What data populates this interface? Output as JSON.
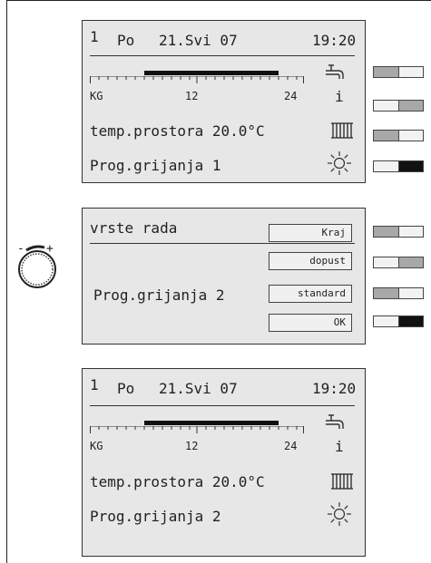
{
  "panel_top": {
    "line_no": "1",
    "day": "Po",
    "date": "21.Svi 07",
    "time": "19:20",
    "scale_left": "KG",
    "scale_mid": "12",
    "scale_right": "24",
    "info_symbol": "i",
    "room_temp": "temp.prostora 20.0°C",
    "program": "Prog.grijanja 1",
    "icons": [
      "tap-icon",
      "info-icon",
      "radiator-icon",
      "sun-icon"
    ]
  },
  "panel_mode": {
    "title": "vrste rada",
    "program": "Prog.grijanja 2",
    "options": [
      "Kraj",
      "dopust",
      "standard",
      "OK"
    ]
  },
  "panel_bottom": {
    "line_no": "1",
    "day": "Po",
    "date": "21.Svi 07",
    "time": "19:20",
    "scale_left": "KG",
    "scale_mid": "12",
    "scale_right": "24",
    "info_symbol": "i",
    "room_temp": "temp.prostora 20.0°C",
    "program": "Prog.grijanja 2",
    "icons": [
      "tap-icon",
      "info-icon",
      "radiator-icon",
      "sun-icon"
    ]
  },
  "knob": {
    "minus": "-",
    "plus": "+"
  },
  "colors": {
    "screen_bg": "#e7e7e7",
    "switch_grey": "#a8a8a8",
    "switch_black": "#111111",
    "switch_light": "#f2f2f2"
  },
  "switches_top": [
    "grey-left",
    "grey-right",
    "grey-left",
    "black-right"
  ],
  "switches_mode": [
    "grey-left",
    "grey-right",
    "grey-left",
    "black-right"
  ]
}
